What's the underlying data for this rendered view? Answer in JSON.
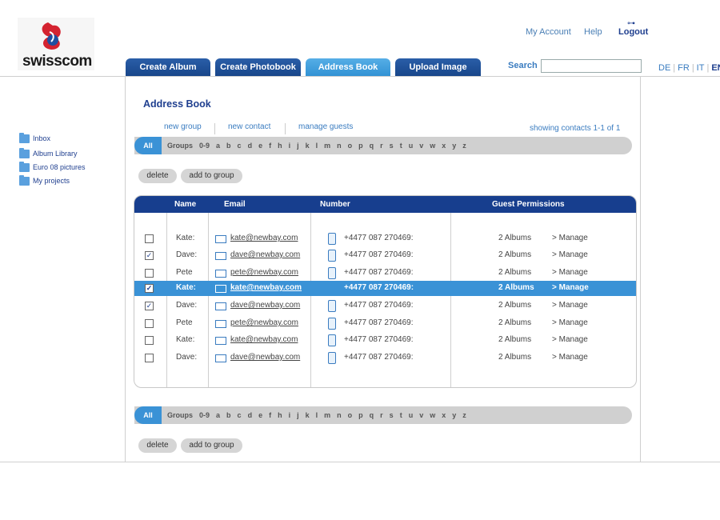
{
  "brand": {
    "name": "swisscom"
  },
  "header": {
    "my_account": "My Account",
    "help": "Help",
    "logout": "Logout",
    "tabs": [
      "Create Album",
      "Create Photobook",
      "Address Book",
      "Upload Image"
    ],
    "search_label": "Search",
    "languages": [
      "DE",
      "FR",
      "IT",
      "EN"
    ]
  },
  "sidebar": {
    "items": [
      "Inbox",
      "Album Library",
      "Euro 08 pictures",
      "My projects"
    ]
  },
  "main": {
    "title": "Address Book",
    "links": [
      "new group",
      "new contact",
      "manage guests"
    ],
    "showing": "showing contacts 1-1 of 1",
    "alpha": {
      "all": "All",
      "letters": [
        "Groups",
        "0-9",
        "a",
        "b",
        "c",
        "d",
        "e",
        "f",
        "h",
        "i",
        "j",
        "k",
        "l",
        "m",
        "n",
        "o",
        "p",
        "q",
        "r",
        "s",
        "t",
        "u",
        "v",
        "w",
        "x",
        "y",
        "z"
      ]
    },
    "delete_label": "delete",
    "add_to_group_label": "add to group",
    "table": {
      "headers": [
        "Name",
        "Email",
        "Number",
        "Guest Permissions"
      ],
      "rows": [
        {
          "name": "Kate:",
          "email": "kate@newbay.com",
          "number": "+4477 087 270469:",
          "albums": "2 Albums",
          "manage": "> Manage",
          "checked": false,
          "selected": false
        },
        {
          "name": "Dave:",
          "email": "dave@newbay.com",
          "number": "+4477 087 270469:",
          "albums": "2 Albums",
          "manage": "> Manage",
          "checked": true,
          "selected": false
        },
        {
          "name": "Pete",
          "email": "pete@newbay.com",
          "number": "+4477 087 270469:",
          "albums": "2 Albums",
          "manage": "> Manage",
          "checked": false,
          "selected": false
        },
        {
          "name": "Kate:",
          "email": "kate@newbay.com",
          "number": "+4477 087 270469:",
          "albums": "2 Albums",
          "manage": "> Manage",
          "checked": true,
          "selected": true
        },
        {
          "name": "Dave:",
          "email": "dave@newbay.com",
          "number": "+4477 087 270469:",
          "albums": "2 Albums",
          "manage": "> Manage",
          "checked": true,
          "selected": false
        },
        {
          "name": "Pete",
          "email": "pete@newbay.com",
          "number": "+4477 087 270469:",
          "albums": "2 Albums",
          "manage": "> Manage",
          "checked": false,
          "selected": false
        },
        {
          "name": "Kate:",
          "email": "kate@newbay.com",
          "number": "+4477 087 270469:",
          "albums": "2 Albums",
          "manage": "> Manage",
          "checked": false,
          "selected": false
        },
        {
          "name": "Dave:",
          "email": "dave@newbay.com",
          "number": "+4477 087 270469:",
          "albums": "2 Albums",
          "manage": "> Manage",
          "checked": false,
          "selected": false
        }
      ]
    }
  }
}
